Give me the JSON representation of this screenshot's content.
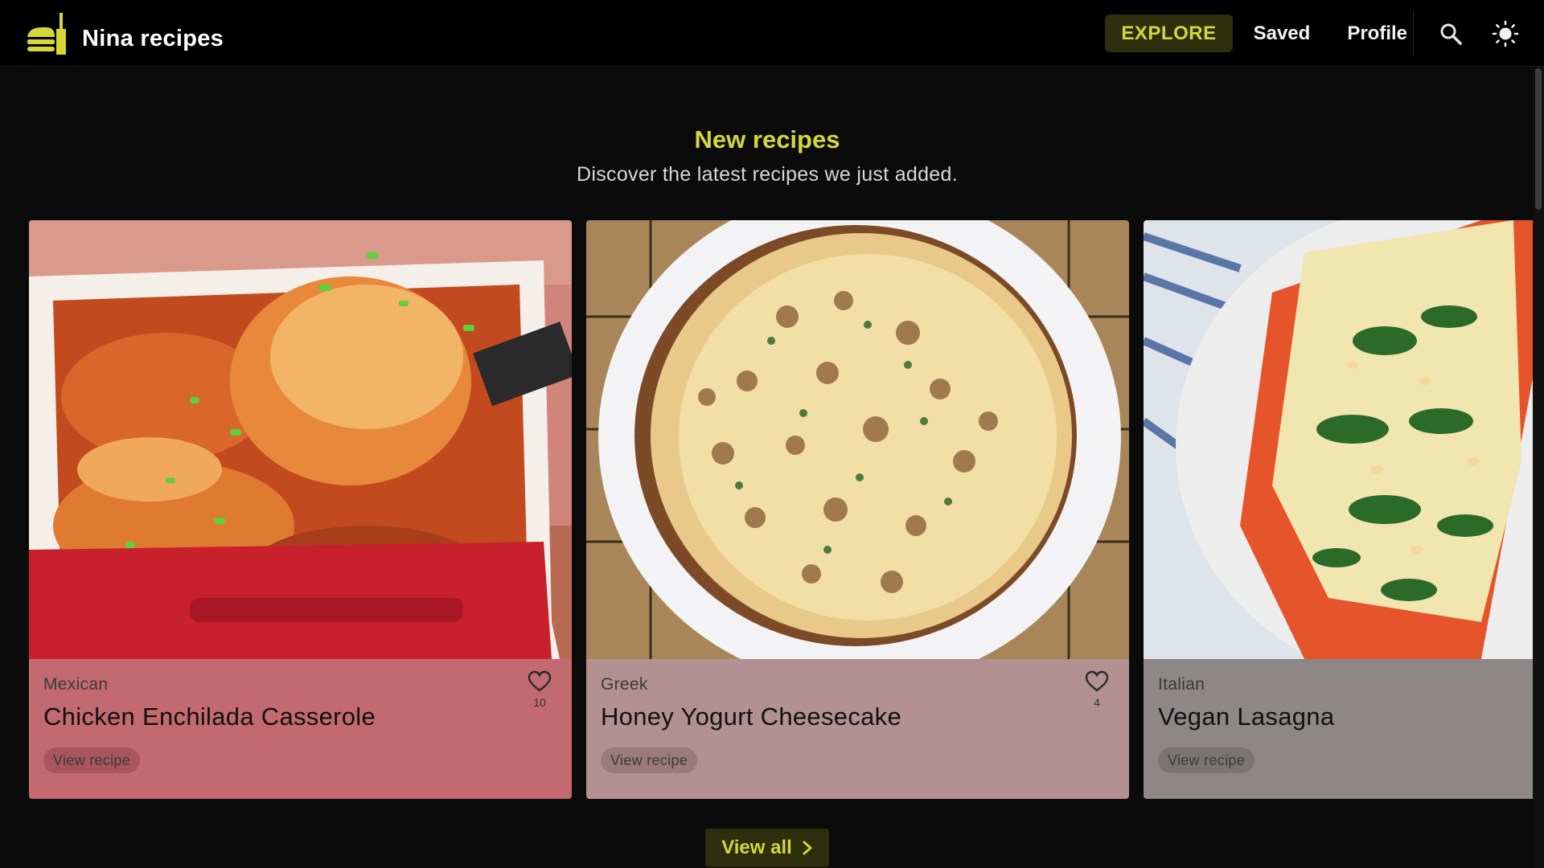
{
  "app": {
    "name": "Nina recipes"
  },
  "nav": {
    "items": [
      {
        "label": "EXPLORE",
        "active": true
      },
      {
        "label": "Saved",
        "active": false
      },
      {
        "label": "Profile",
        "active": false
      }
    ],
    "search_icon": "search-icon",
    "theme_icon": "sun-icon"
  },
  "section": {
    "title": "New recipes",
    "subtitle": "Discover the latest recipes we just added."
  },
  "cards": [
    {
      "cuisine": "Mexican",
      "title": "Chicken Enchilada Casserole",
      "button": "View recipe",
      "likes": "10",
      "bg": "#c26a70",
      "btn_bg": "#a9555b"
    },
    {
      "cuisine": "Greek",
      "title": "Honey Yogurt Cheesecake",
      "button": "View recipe",
      "likes": "4",
      "bg": "#b39193",
      "btn_bg": "#9b7a7c"
    },
    {
      "cuisine": "Italian",
      "title": "Vegan Lasagna",
      "button": "View recipe",
      "likes": "",
      "bg": "#8d8787",
      "btn_bg": "#7a7474"
    }
  ],
  "view_all": {
    "label": "View all"
  },
  "colors": {
    "accent": "#d4d63a",
    "accent_bg": "#2c2e0c",
    "background": "#0b0b0b"
  }
}
